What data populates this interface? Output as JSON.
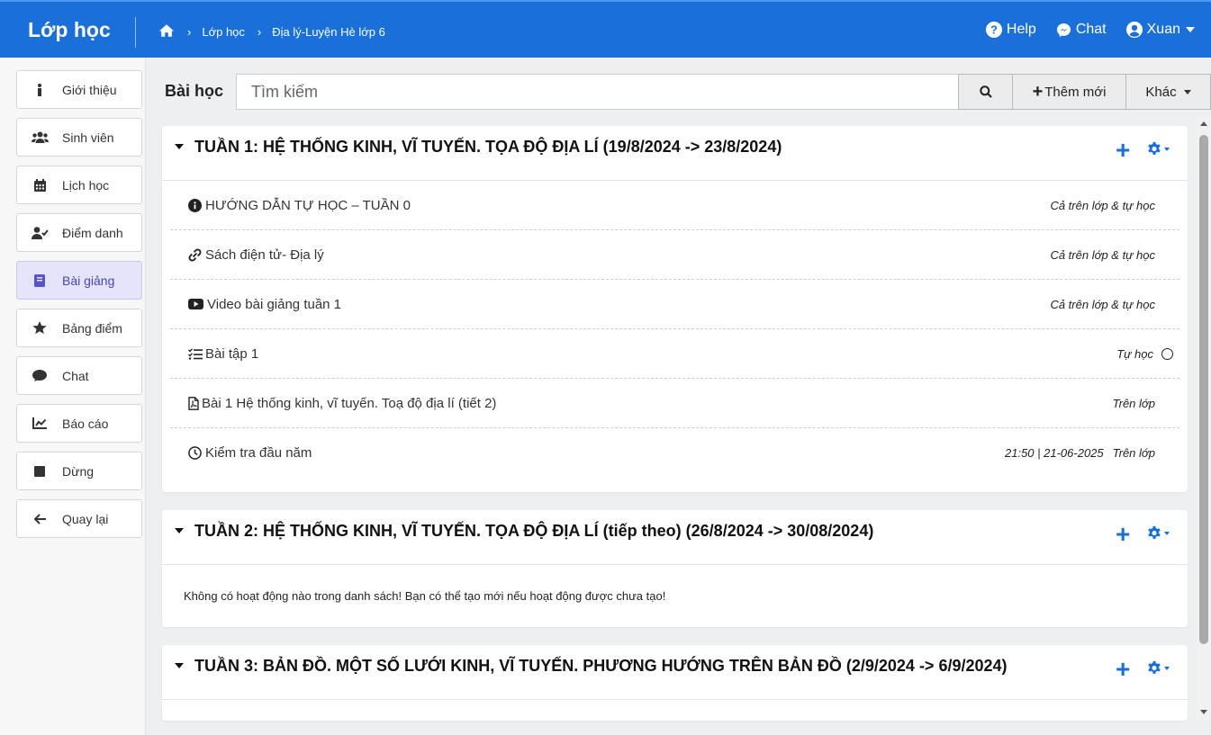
{
  "topbar": {
    "brand": "Lớp học",
    "breadcrumbs": [
      "Lớp học",
      "Địa lý-Luyện Hè lớp 6"
    ],
    "help": "Help",
    "chat": "Chat",
    "user": "Xuan"
  },
  "sidebar": {
    "items": [
      {
        "label": "Giới thiệu",
        "icon": "info-icon"
      },
      {
        "label": "Sinh viên",
        "icon": "users-icon"
      },
      {
        "label": "Lịch học",
        "icon": "calendar-icon"
      },
      {
        "label": "Điểm danh",
        "icon": "user-check-icon"
      },
      {
        "label": "Bài giảng",
        "icon": "book-icon",
        "active": true
      },
      {
        "label": "Bảng điểm",
        "icon": "star-icon"
      },
      {
        "label": "Chat",
        "icon": "comment-icon"
      },
      {
        "label": "Báo cáo",
        "icon": "chart-line-icon"
      },
      {
        "label": "Dừng",
        "icon": "stop-icon"
      },
      {
        "label": "Quay lại",
        "icon": "arrow-left-icon"
      }
    ]
  },
  "lessons": {
    "title": "Bài học",
    "search_placeholder": "Tìm kiếm",
    "add_label": "Thêm mới",
    "more_label": "Khác"
  },
  "weeks": [
    {
      "title": "TUẦN 1: HỆ THỐNG KINH, VĨ TUYẾN. TỌA ĐỘ ĐỊA LÍ (19/8/2024 -> 23/8/2024)",
      "items": [
        {
          "icon": "info-circle-icon",
          "label": "HƯỚNG DẪN TỰ HỌC – TUẦN 0",
          "mode": "Cả trên lớp & tự học"
        },
        {
          "icon": "link-icon",
          "label": "Sách điện tử- Địa lý",
          "mode": "Cả trên lớp & tự học"
        },
        {
          "icon": "youtube-icon",
          "label": "Video bài giảng tuần 1",
          "mode": "Cả trên lớp & tự học"
        },
        {
          "icon": "tasks-icon",
          "label": "Bài tập 1",
          "mode": "Tự học"
        },
        {
          "icon": "pdf-file-icon",
          "label": "Bài 1 Hệ thống kinh, vĩ tuyến. Toạ độ địa lí (tiết 2)",
          "mode": "Trên lớp"
        },
        {
          "icon": "clock-icon",
          "label": "Kiểm tra đầu năm",
          "time": "21:50 | 21-06-2025",
          "mode": "Trên lớp"
        }
      ]
    },
    {
      "title": "TUẦN 2: HỆ THỐNG KINH, VĨ TUYẾN. TỌA ĐỘ ĐỊA LÍ (tiếp theo) (26/8/2024 -> 30/08/2024)",
      "empty_message": "Không có hoạt động nào trong danh sách! Bạn có thể tạo mới nếu hoạt động được chưa tạo!"
    },
    {
      "title": "TUẦN 3: BẢN ĐỒ. MỘT SỐ LƯỚI KINH, VĨ TUYẾN. PHƯƠNG HƯỚNG TRÊN BẢN ĐỒ (2/9/2024 -> 6/9/2024)"
    }
  ],
  "colors": {
    "topbar": "#1a6fd8",
    "accent": "#1a6fd8",
    "sidebar_active_bg": "#e5e4fb",
    "sidebar_active_text": "#4a44b5"
  }
}
